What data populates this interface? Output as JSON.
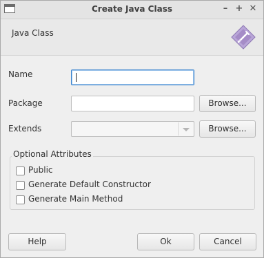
{
  "window": {
    "title": "Create Java Class",
    "controls": {
      "minimize": "–",
      "maximize": "+",
      "close": "✕"
    }
  },
  "header": {
    "title": "Java Class",
    "icon": "java-class-wizard-icon"
  },
  "form": {
    "name": {
      "label": "Name",
      "value": ""
    },
    "package": {
      "label": "Package",
      "value": "",
      "browse": "Browse..."
    },
    "extends": {
      "label": "Extends",
      "value": "",
      "browse": "Browse..."
    }
  },
  "optional": {
    "title": "Optional Attributes",
    "options": [
      {
        "label": "Public",
        "checked": false
      },
      {
        "label": "Generate Default Constructor",
        "checked": false
      },
      {
        "label": "Generate Main Method",
        "checked": false
      }
    ]
  },
  "buttons": {
    "help": "Help",
    "ok": "Ok",
    "cancel": "Cancel"
  },
  "colors": {
    "focus": "#3a83cf",
    "icon_purple": "#a58cc7"
  }
}
